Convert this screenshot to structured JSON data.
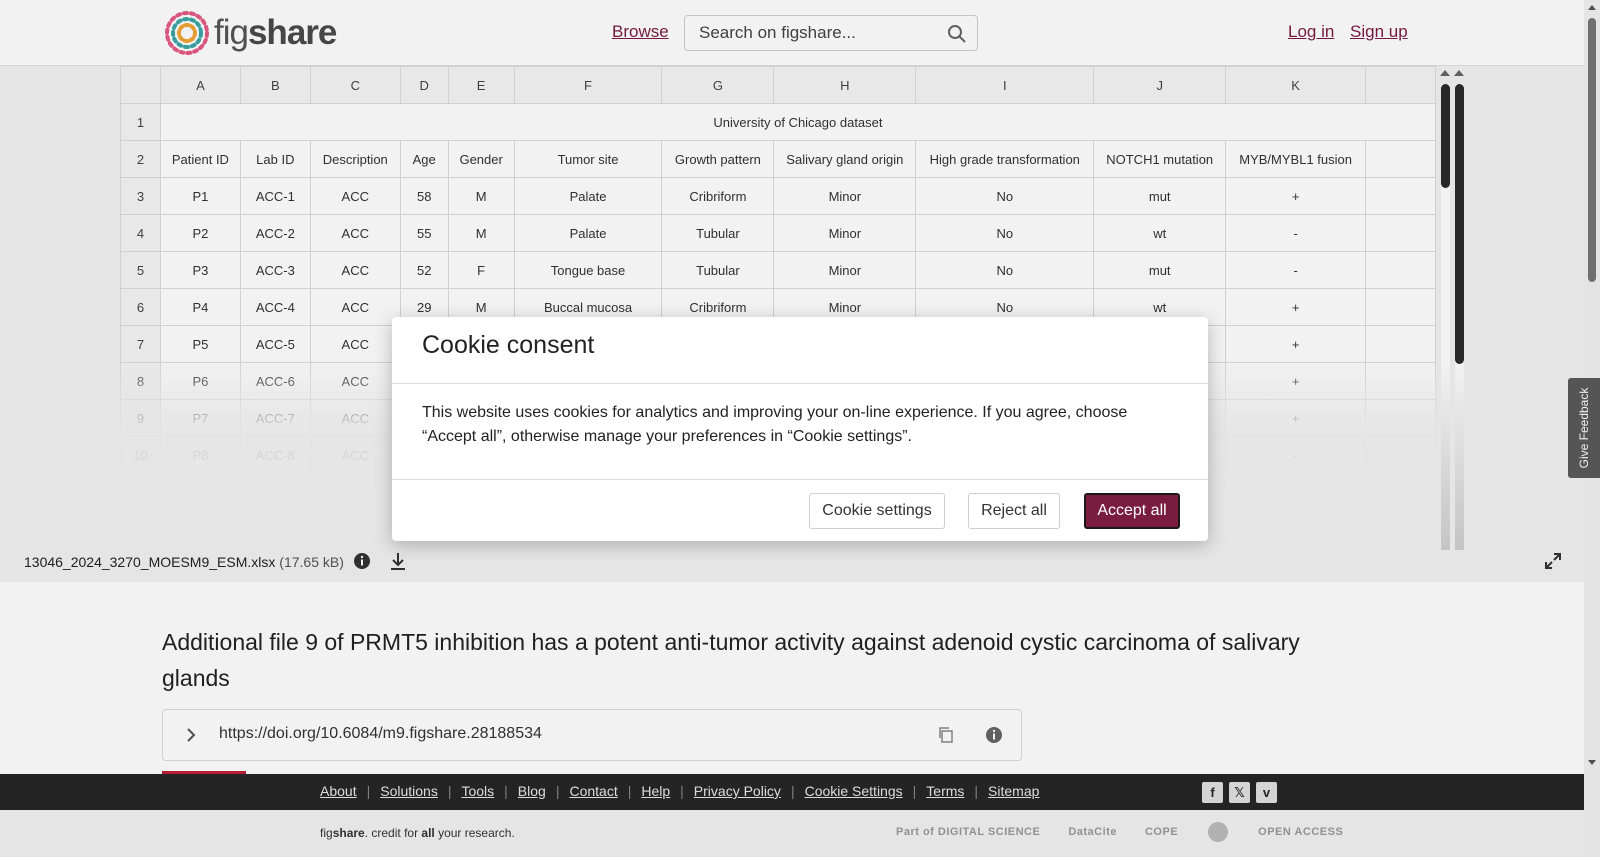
{
  "header": {
    "logo_text_fig": "fig",
    "logo_text_share": "share",
    "browse": "Browse",
    "search_placeholder": "Search on figshare...",
    "login": "Log in",
    "signup": "Sign up"
  },
  "sheet": {
    "columns": [
      "A",
      "B",
      "C",
      "D",
      "E",
      "F",
      "G",
      "H",
      "I",
      "J",
      "K"
    ],
    "merged_title": "University of Chicago dataset",
    "headers": [
      "Patient ID",
      "Lab ID",
      "Description",
      "Age",
      "Gender",
      "Tumor site",
      "Growth pattern",
      "Salivary gland origin",
      "High grade transformation",
      "NOTCH1 mutation",
      "MYB/MYBL1 fusion"
    ],
    "rows": [
      [
        "3",
        "P1",
        "ACC-1",
        "ACC",
        "58",
        "M",
        "Palate",
        "Cribriform",
        "Minor",
        "No",
        "mut",
        "+"
      ],
      [
        "4",
        "P2",
        "ACC-2",
        "ACC",
        "55",
        "M",
        "Palate",
        "Tubular",
        "Minor",
        "No",
        "wt",
        "-"
      ],
      [
        "5",
        "P3",
        "ACC-3",
        "ACC",
        "52",
        "F",
        "Tongue base",
        "Tubular",
        "Minor",
        "No",
        "mut",
        "-"
      ],
      [
        "6",
        "P4",
        "ACC-4",
        "ACC",
        "29",
        "M",
        "Buccal mucosa",
        "Cribriform",
        "Minor",
        "No",
        "wt",
        "+"
      ],
      [
        "7",
        "P5",
        "ACC-5",
        "ACC",
        "",
        "",
        "",
        "",
        "",
        "",
        "",
        "+"
      ],
      [
        "8",
        "P6",
        "ACC-6",
        "ACC",
        "",
        "",
        "",
        "",
        "",
        "",
        "",
        "+"
      ],
      [
        "9",
        "P7",
        "ACC-7",
        "ACC",
        "",
        "",
        "",
        "",
        "",
        "",
        "",
        "+"
      ],
      [
        "10",
        "P8",
        "ACC-8",
        "ACC",
        "",
        "",
        "",
        "",
        "",
        "",
        "",
        "-"
      ]
    ]
  },
  "file": {
    "name": "13046_2024_3270_MOESM9_ESM.xlsx",
    "size": "(17.65 kB)"
  },
  "content": {
    "title": "Additional file 9 of PRMT5 inhibition has a potent anti-tumor activity against adenoid cystic carcinoma of salivary glands",
    "doi": "https://doi.org/10.6084/m9.figshare.28188534"
  },
  "footer": {
    "links": [
      "About",
      "Solutions",
      "Tools",
      "Blog",
      "Contact",
      "Help",
      "Privacy Policy",
      "Cookie Settings",
      "Terms",
      "Sitemap"
    ],
    "tagline_fig": "fig",
    "tagline_share": "share",
    "tagline_mid": ". credit for ",
    "tagline_all": "all",
    "tagline_end": " your research.",
    "partners": [
      "Part of DIGITAL SCIENCE",
      "DataCite",
      "COPE",
      "",
      "OPEN ACCESS"
    ]
  },
  "feedback": "Give Feedback",
  "cookie": {
    "title": "Cookie consent",
    "body": "This website uses cookies for analytics and improving your on-line experience. If you agree, choose “Accept all”, otherwise manage your preferences in “Cookie settings”.",
    "settings": "Cookie settings",
    "reject": "Reject all",
    "accept": "Accept all"
  },
  "colors": {
    "brand": "#7a1c3e",
    "footer_dark": "#262626"
  }
}
